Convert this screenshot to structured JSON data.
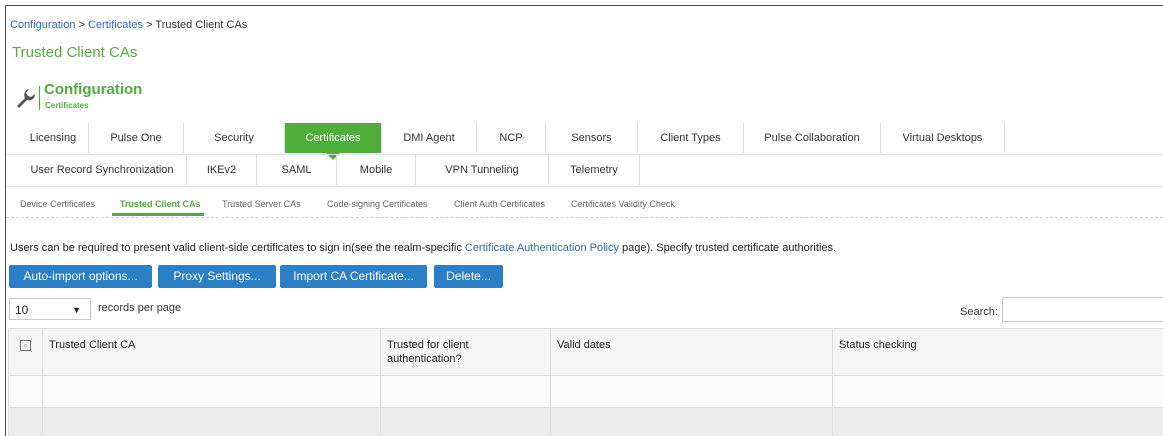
{
  "breadcrumb": {
    "items": [
      "Configuration",
      "Certificates"
    ],
    "separator": ">",
    "current": "Trusted Client CAs"
  },
  "page_title": "Trusted Client CAs",
  "header": {
    "icon": "wrench-icon",
    "title": "Configuration",
    "subtitle": "Certificates"
  },
  "tabs_row1": [
    "Licensing",
    "Pulse One",
    "Security",
    "Certificates",
    "DMI Agent",
    "NCP",
    "Sensors",
    "Client Types",
    "Pulse Collaboration",
    "Virtual Desktops"
  ],
  "tabs_row2": [
    "User Record Synchronization",
    "IKEv2",
    "SAML",
    "Mobile",
    "VPN Tunneling",
    "Telemetry"
  ],
  "active_tab": "Certificates",
  "subtabs": [
    "Device Certificates",
    "Trusted Client CAs",
    "Trusted Server CAs",
    "Code-signing Certificates",
    "Client Auth Certificates",
    "Certificates Validity Check"
  ],
  "active_subtab": "Trusted Client CAs",
  "description": {
    "before": "Users can be required to present valid client-side certificates to sign in(see the realm-specific ",
    "link": "Certificate Authentication Policy",
    "after": " page). Specify trusted certificate authorities."
  },
  "buttons": [
    "Auto-import options...",
    "Proxy Settings...",
    "Import CA Certificate...",
    "Delete..."
  ],
  "pagination": {
    "page_size": "10",
    "records_label": "records per page"
  },
  "search": {
    "label": "Search:",
    "value": ""
  },
  "table": {
    "columns": [
      "Trusted Client CA",
      "Trusted for client authentication?",
      "Valid dates",
      "Status checking"
    ]
  },
  "colors": {
    "accent": "#4fae3b",
    "button": "#2a7fc6",
    "link": "#2a6ebb"
  }
}
